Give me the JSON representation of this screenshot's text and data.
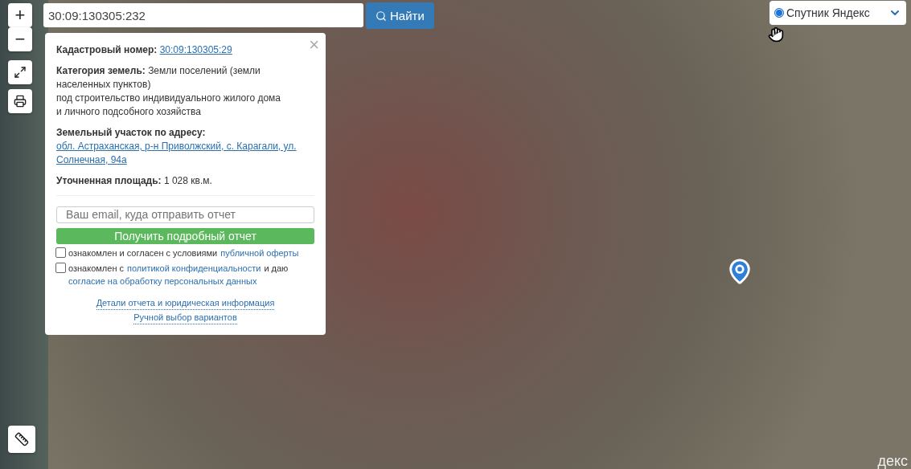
{
  "search": {
    "value": "30:09:130305:232",
    "button": "Найти"
  },
  "zoom_controls": {
    "zoom_in": "+",
    "zoom_out": "−"
  },
  "layer_select": {
    "label": "Спутник Яндекс",
    "selected": true
  },
  "info_panel": {
    "cadastral_label": "Кадастровый номер:",
    "cadastral_number": "30:09:130305:29",
    "category_label": "Категория земель:",
    "category_value": "Земли поселений (земли населенных пунктов)",
    "usage": "под строительство индивидуального жилого дома и личного подсобного хозяйства",
    "address_label": "Земельный участок по адресу:",
    "address_value": "обл. Астраханская, р-н Приволжский, с. Карагали, ул. Солнечная, 94а",
    "area_label": "Уточненная площадь:",
    "area_value": "1 028 кв.м.",
    "email_placeholder": "Ваш email, куда отправить отчет",
    "submit": "Получить подробный отчет",
    "close": "×",
    "consents": [
      {
        "checked": false,
        "parts": [
          {
            "text": "ознакомлен и согласен с условиями",
            "kind": "text"
          },
          {
            "text": "публичной оферты",
            "kind": "link"
          }
        ]
      },
      {
        "checked": false,
        "parts": [
          {
            "text": "ознакомлен с",
            "kind": "text"
          },
          {
            "text": "политикой конфиденциальности",
            "kind": "link"
          },
          {
            "text": "и даю",
            "kind": "text"
          },
          {
            "text": "согласие на обработку персональных данных",
            "kind": "link"
          }
        ]
      }
    ],
    "links": [
      "Детали отчета и юридическая информация",
      "Ручной выбор вариантов"
    ]
  },
  "map_logo": "декс"
}
